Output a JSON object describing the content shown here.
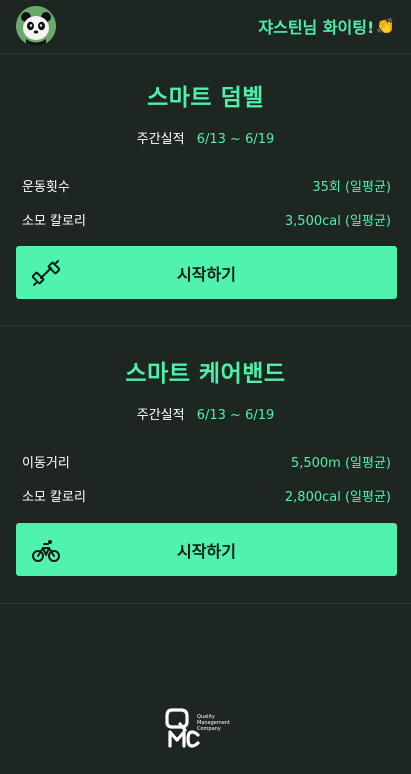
{
  "header": {
    "greeting": "쟈스틴님 화이팅!",
    "greeting_emoji": "👏",
    "avatar_icon": "panda-icon"
  },
  "sections": [
    {
      "title": "스마트 덤벨",
      "weekly_label": "주간실적",
      "weekly_range": "6/13 ~ 6/19",
      "stats": [
        {
          "label": "운동횟수",
          "value": "35회 (일평균)"
        },
        {
          "label": "소모 칼로리",
          "value": "3,500cal (일평균)"
        }
      ],
      "button_label": "시작하기",
      "button_icon": "dumbbell-icon"
    },
    {
      "title": "스마트 케어밴드",
      "weekly_label": "주간실적",
      "weekly_range": "6/13 ~ 6/19",
      "stats": [
        {
          "label": "이동거리",
          "value": "5,500m (일평균)"
        },
        {
          "label": "소모 칼로리",
          "value": "2,800cal (일평균)"
        }
      ],
      "button_label": "시작하기",
      "button_icon": "bicycle-icon"
    }
  ],
  "footer": {
    "logo_text": [
      "Quality",
      "Management",
      "Company"
    ],
    "logo_mark": "QMC"
  },
  "colors": {
    "background": "#1e2621",
    "accent": "#4ef0aa",
    "button": "#50f3ad",
    "button_text": "#111a15"
  }
}
